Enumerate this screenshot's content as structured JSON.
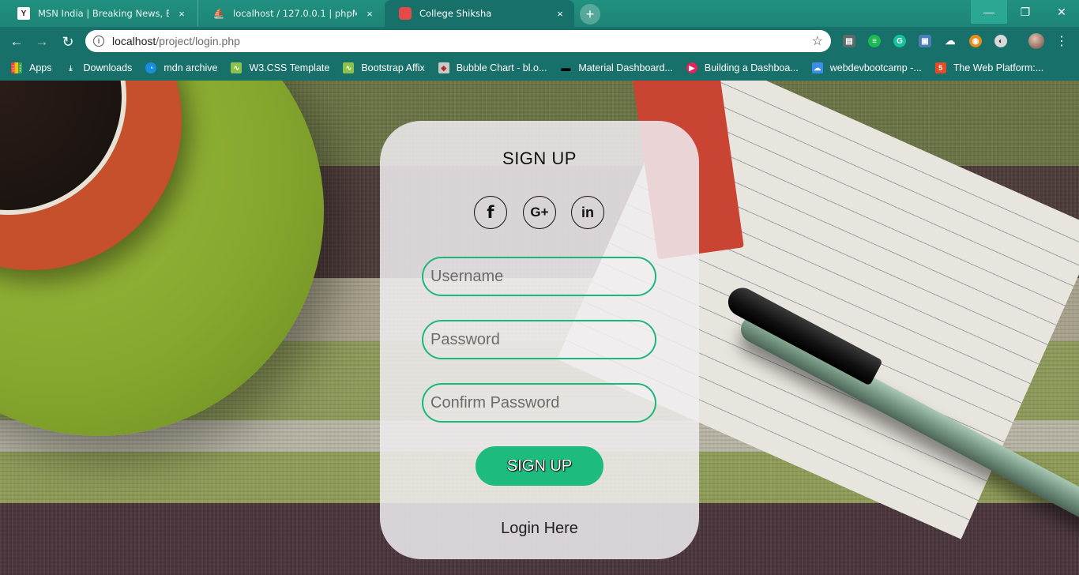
{
  "browser": {
    "tabs": [
      {
        "title": "MSN India | Breaking News, Ente",
        "favicon": "msn-icon",
        "close": "×"
      },
      {
        "title": "localhost / 127.0.0.1 | phpMyAdm",
        "favicon": "phpmyadmin-icon",
        "close": "×"
      },
      {
        "title": "College Shiksha",
        "favicon": "college-shiksha-icon",
        "close": "×",
        "active": true
      }
    ],
    "new_tab": "+",
    "address": {
      "host": "localhost",
      "path": "/project/login.php"
    },
    "window_controls": {
      "minimize": "—",
      "maximize": "❐",
      "close": "✕"
    },
    "accent_color": "#17706a"
  },
  "bookmarks": [
    {
      "label": "Apps",
      "icon": "apps-grid-icon"
    },
    {
      "label": "Downloads",
      "icon": "download-icon"
    },
    {
      "label": "mdn archive",
      "icon": "mdn-icon"
    },
    {
      "label": "W3.CSS Template",
      "icon": "w3-icon"
    },
    {
      "label": "Bootstrap Affix",
      "icon": "w3-icon"
    },
    {
      "label": "Bubble Chart - bl.o...",
      "icon": "cube-icon"
    },
    {
      "label": "Material Dashboard...",
      "icon": "mask-icon"
    },
    {
      "label": "Building a Dashboa...",
      "icon": "play-icon"
    },
    {
      "label": "webdevbootcamp -...",
      "icon": "cloud-icon"
    },
    {
      "label": "The Web Platform:...",
      "icon": "html5-icon"
    }
  ],
  "signup": {
    "title": "SIGN UP",
    "social": [
      {
        "label": "f",
        "icon": "facebook-icon"
      },
      {
        "label": "G+",
        "icon": "google-plus-icon"
      },
      {
        "label": "in",
        "icon": "linkedin-icon"
      }
    ],
    "username_placeholder": "Username",
    "password_placeholder": "Password",
    "confirm_placeholder": "Confirm Password",
    "submit_label": "SIGN UP",
    "login_link": "Login Here",
    "accent_color": "#1ab977"
  }
}
